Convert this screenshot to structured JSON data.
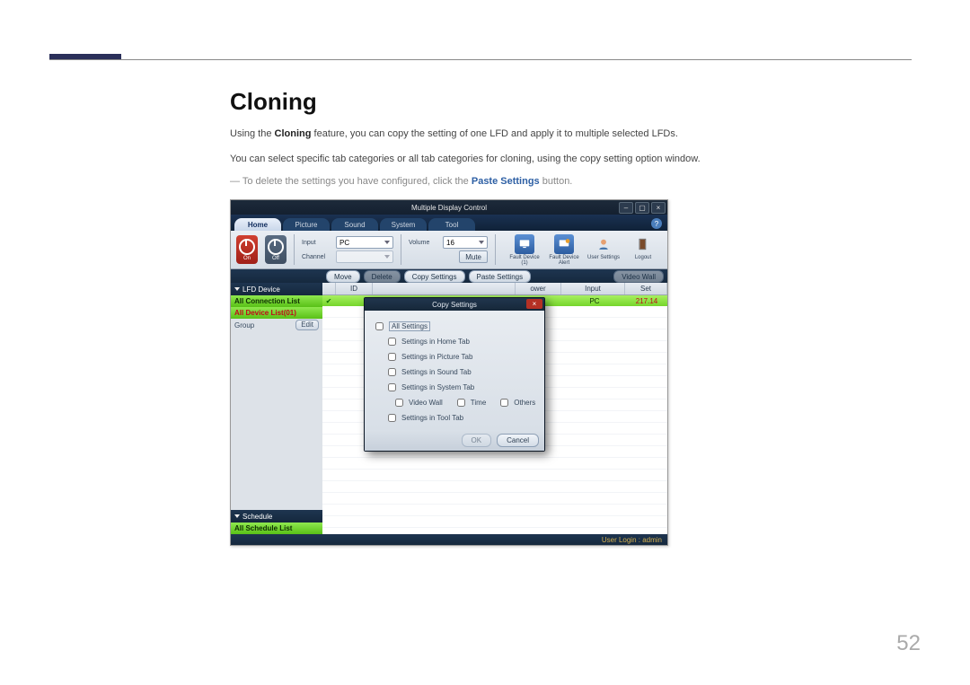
{
  "doc": {
    "heading": "Cloning",
    "p1_a": "Using the ",
    "p1_bold": "Cloning",
    "p1_b": " feature, you can copy the setting of one LFD and apply it to multiple selected LFDs.",
    "p2": "You can select specific tab categories or all tab categories for cloning, using the copy setting option window.",
    "note_a": "― To delete the settings you have configured, click the ",
    "note_bold": "Paste Settings",
    "note_b": " button.",
    "pagenum": "52"
  },
  "app": {
    "title": "Multiple Display Control",
    "tabs": [
      "Home",
      "Picture",
      "Sound",
      "System",
      "Tool"
    ],
    "help": "?",
    "ribbon": {
      "on": "On",
      "off": "Off",
      "input": "Input",
      "input_val": "PC",
      "channel": "Channel",
      "volume": "Volume",
      "volume_val": "16",
      "mute": "Mute",
      "icons": {
        "fd": "Fault Device (1)",
        "fda": "Fault Device Alert",
        "us": "User Settings",
        "lo": "Logout"
      }
    },
    "tb2": {
      "move": "Move",
      "delete": "Delete",
      "copy": "Copy Settings",
      "paste": "Paste Settings",
      "vw": "Video Wall"
    },
    "sidebar": {
      "lfd": "LFD Device",
      "all_conn": "All Connection List",
      "all_dev": "All Device List(01)",
      "group": "Group",
      "edit": "Edit",
      "schedule": "Schedule",
      "all_sched": "All Schedule List"
    },
    "grid": {
      "cols": {
        "id": "ID",
        "power": "ower",
        "input": "Input",
        "set": "Set"
      },
      "row1": {
        "power_frag": "",
        "input": "PC",
        "set": "217.14"
      }
    },
    "dialog": {
      "title": "Copy Settings",
      "opts": {
        "all": "All Settings",
        "home": "Settings in Home Tab",
        "picture": "Settings in Picture Tab",
        "sound": "Settings in Sound Tab",
        "system": "Settings in System Tab",
        "vw": "Video Wall",
        "time": "Time",
        "others": "Others",
        "tool": "Settings in Tool Tab"
      },
      "ok": "OK",
      "cancel": "Cancel"
    },
    "status": "User Login : admin"
  }
}
